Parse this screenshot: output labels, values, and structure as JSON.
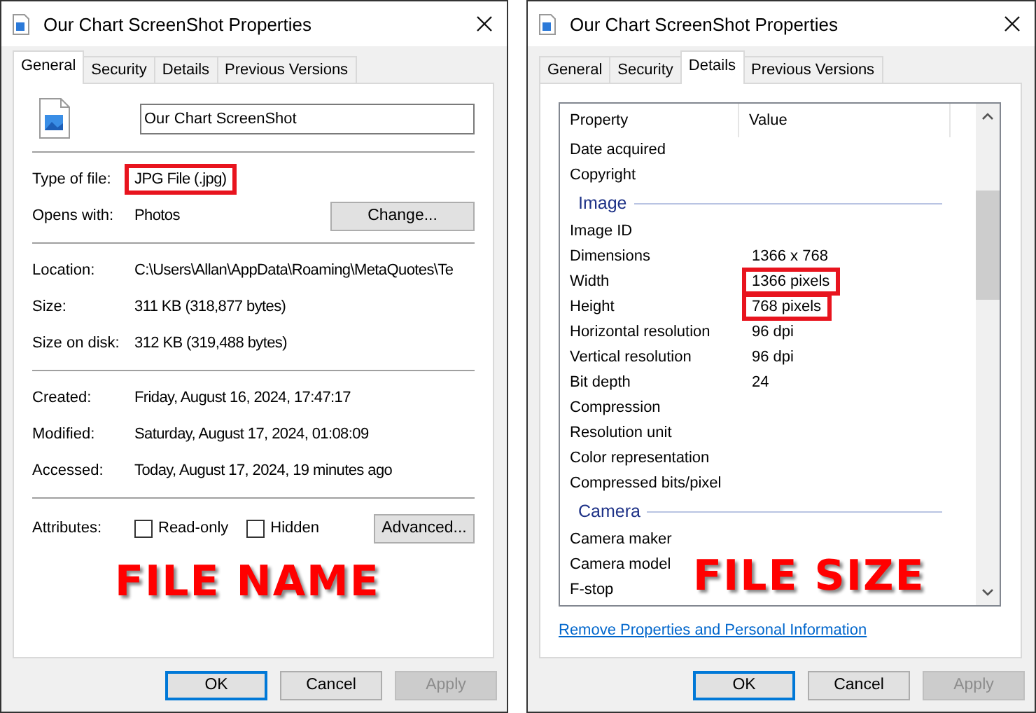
{
  "dialogs": [
    {
      "kind": "general",
      "title": "Our Chart ScreenShot Properties",
      "tabs": [
        {
          "label": "General",
          "selected": true
        },
        {
          "label": "Security",
          "selected": false
        },
        {
          "label": "Details",
          "selected": false
        },
        {
          "label": "Previous Versions",
          "selected": false
        }
      ],
      "file_name": "Our Chart ScreenShot",
      "groups": [
        [
          {
            "label": "Type of file:",
            "value": "JPG File (.jpg)",
            "highlighted": true
          },
          {
            "label": "Opens with:",
            "value": "Photos",
            "highlighted": false,
            "button": "Change..."
          }
        ],
        [
          {
            "label": "Location:",
            "value": "C:\\Users\\Allan\\AppData\\Roaming\\MetaQuotes\\Te",
            "highlighted": false
          },
          {
            "label": "Size:",
            "value": "311 KB (318,877 bytes)",
            "highlighted": false
          },
          {
            "label": "Size on disk:",
            "value": "312 KB (319,488 bytes)",
            "highlighted": false
          }
        ],
        [
          {
            "label": "Created:",
            "value": "Friday, August 16, 2024, 17:47:17",
            "highlighted": false
          },
          {
            "label": "Modified:",
            "value": "Saturday, August 17, 2024, 01:08:09",
            "highlighted": false
          },
          {
            "label": "Accessed:",
            "value": "Today, August 17, 2024, 19 minutes ago",
            "highlighted": false
          }
        ]
      ],
      "attributes_label": "Attributes:",
      "attributes": [
        {
          "label": "Read-only",
          "checked": false
        },
        {
          "label": "Hidden",
          "checked": false
        }
      ],
      "advanced_button": "Advanced...",
      "caption": "FILE NAME",
      "buttons": [
        {
          "label": "OK",
          "default": true,
          "disabled": false
        },
        {
          "label": "Cancel",
          "default": false,
          "disabled": false
        },
        {
          "label": "Apply",
          "default": false,
          "disabled": true
        }
      ]
    },
    {
      "kind": "details",
      "title": "Our Chart ScreenShot Properties",
      "tabs": [
        {
          "label": "General",
          "selected": false
        },
        {
          "label": "Security",
          "selected": false
        },
        {
          "label": "Details",
          "selected": true
        },
        {
          "label": "Previous Versions",
          "selected": false
        }
      ],
      "columns": [
        "Property",
        "Value"
      ],
      "rows": [
        {
          "kind": "row",
          "property": "Date acquired"
        },
        {
          "kind": "row",
          "property": "Copyright"
        },
        {
          "kind": "group",
          "property": "Image"
        },
        {
          "kind": "row",
          "property": "Image ID"
        },
        {
          "kind": "row",
          "property": "Dimensions",
          "value": "1366 x 768",
          "highlighted": false
        },
        {
          "kind": "row",
          "property": "Width",
          "value": "1366 pixels",
          "highlighted": true
        },
        {
          "kind": "row",
          "property": "Height",
          "value": "768 pixels",
          "highlighted": true
        },
        {
          "kind": "row",
          "property": "Horizontal resolution",
          "value": "96 dpi",
          "highlighted": false
        },
        {
          "kind": "row",
          "property": "Vertical resolution",
          "value": "96 dpi",
          "highlighted": false
        },
        {
          "kind": "row",
          "property": "Bit depth",
          "value": "24",
          "highlighted": false
        },
        {
          "kind": "row",
          "property": "Compression"
        },
        {
          "kind": "row",
          "property": "Resolution unit"
        },
        {
          "kind": "row",
          "property": "Color representation"
        },
        {
          "kind": "row",
          "property": "Compressed bits/pixel"
        },
        {
          "kind": "group",
          "property": "Camera"
        },
        {
          "kind": "row",
          "property": "Camera maker"
        },
        {
          "kind": "row",
          "property": "Camera model"
        },
        {
          "kind": "row",
          "property": "F-stop"
        }
      ],
      "link": "Remove Properties and Personal Information",
      "caption": "FILE SIZE",
      "buttons": [
        {
          "label": "OK",
          "default": true,
          "disabled": false
        },
        {
          "label": "Cancel",
          "default": false,
          "disabled": false
        },
        {
          "label": "Apply",
          "default": false,
          "disabled": true
        }
      ]
    }
  ]
}
